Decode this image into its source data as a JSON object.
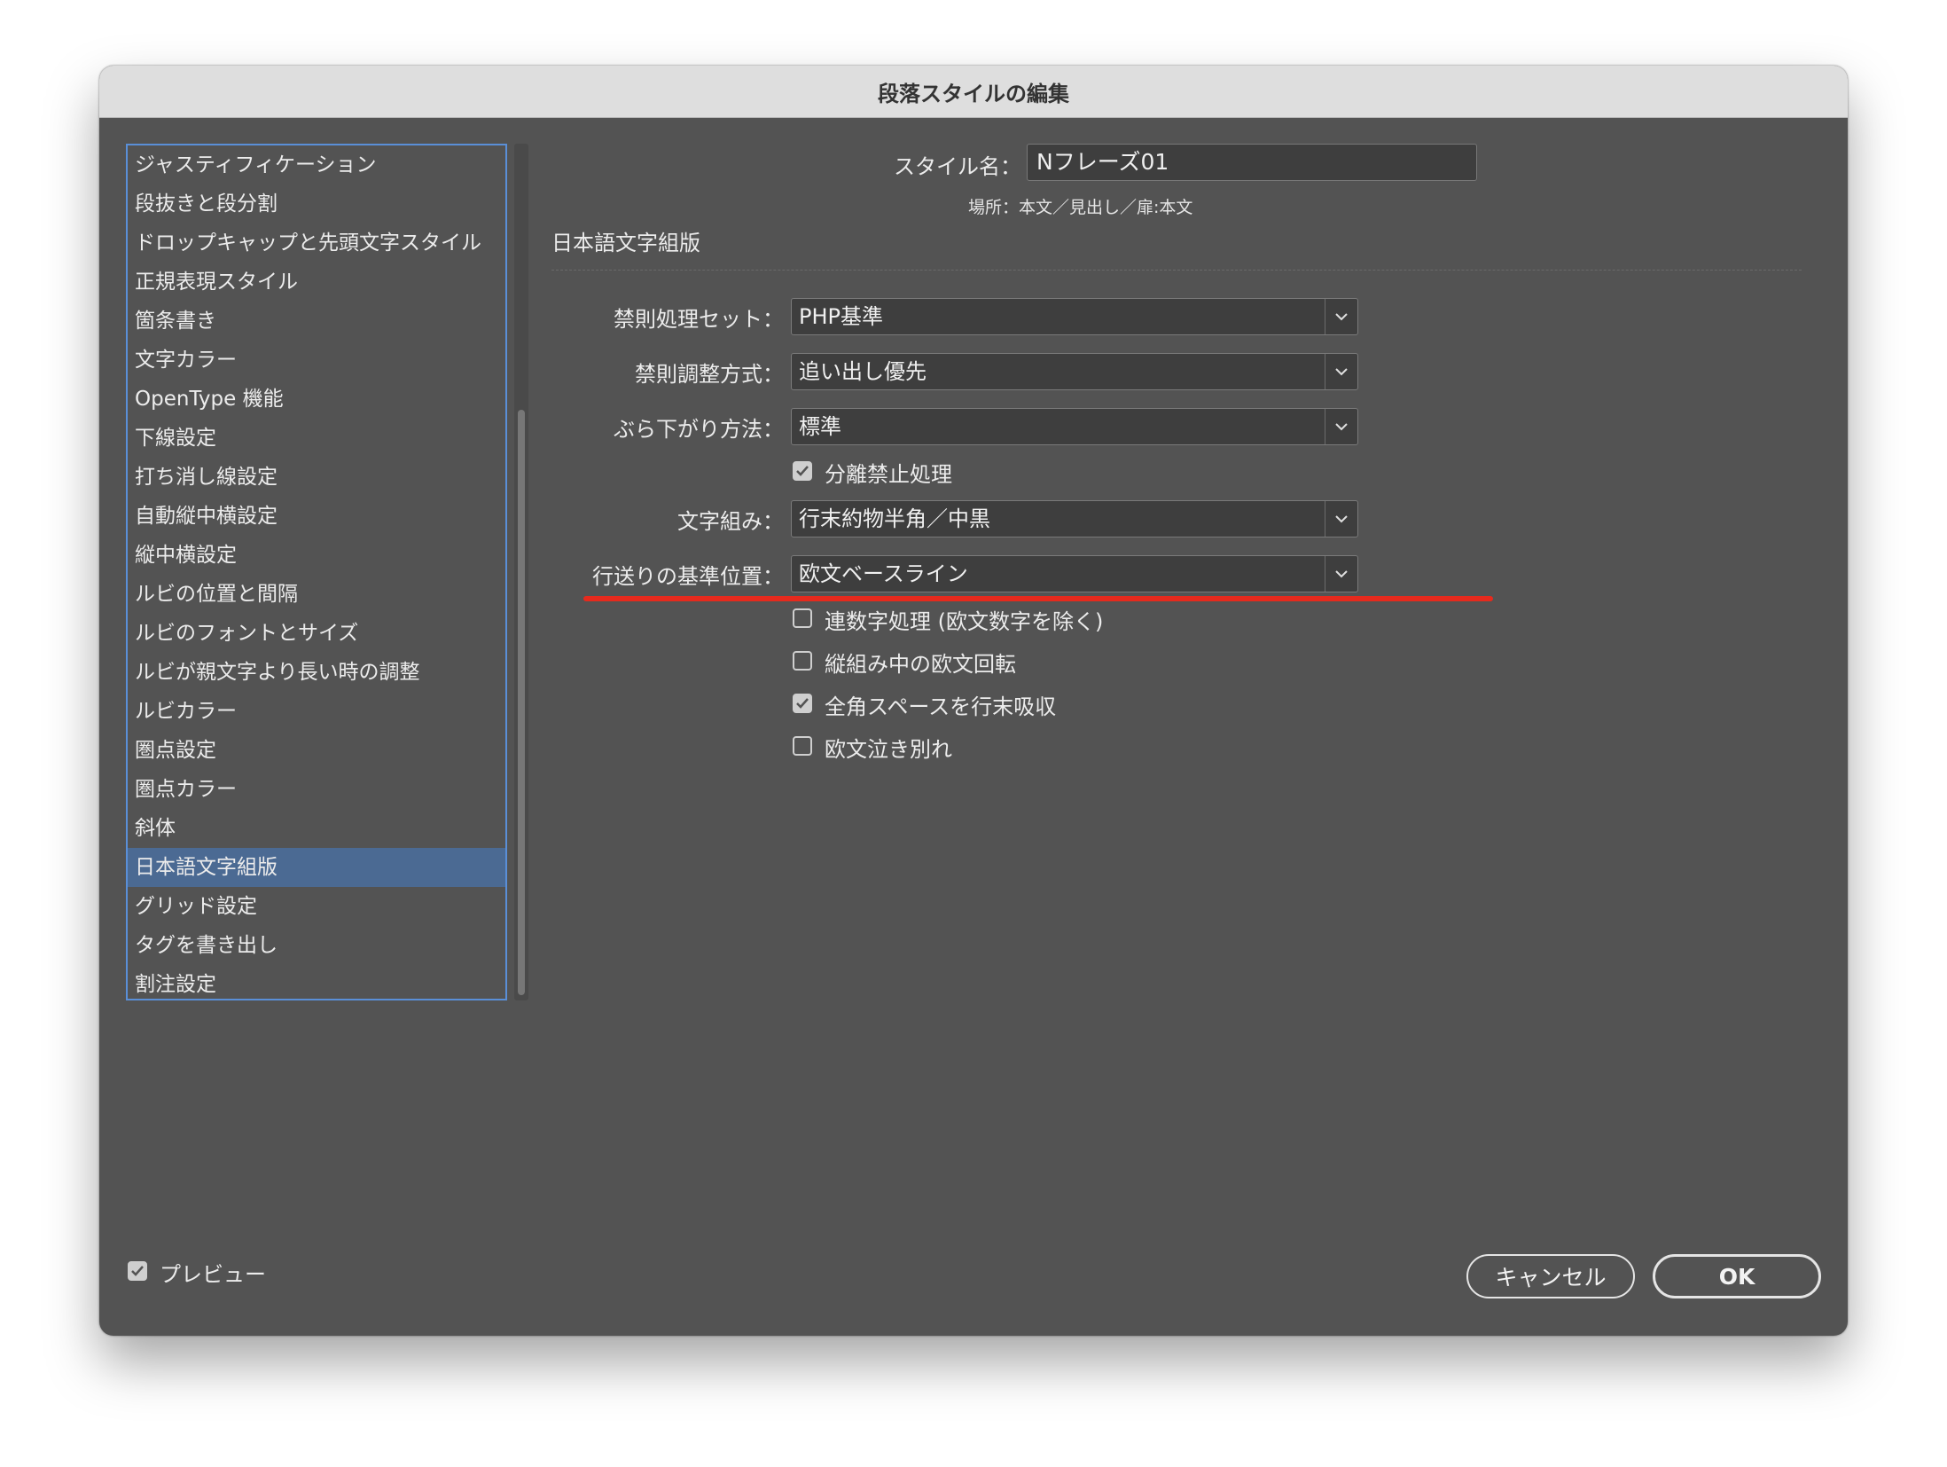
{
  "window": {
    "title": "段落スタイルの編集"
  },
  "sidebar": {
    "selected_index": 18,
    "items": [
      "ジャスティフィケーション",
      "段抜きと段分割",
      "ドロップキャップと先頭文字スタイル",
      "正規表現スタイル",
      "箇条書き",
      "文字カラー",
      "OpenType 機能",
      "下線設定",
      "打ち消し線設定",
      "自動縦中横設定",
      "縦中横設定",
      "ルビの位置と間隔",
      "ルビのフォントとサイズ",
      "ルビが親文字より長い時の調整",
      "ルビカラー",
      "圏点設定",
      "圏点カラー",
      "斜体",
      "日本語文字組版",
      "グリッド設定",
      "タグを書き出し",
      "割注設定"
    ]
  },
  "style_name": {
    "label": "スタイル名：",
    "value": "Nフレーズ01"
  },
  "location": "場所：本文／見出し／扉:本文",
  "section": {
    "title": "日本語文字組版"
  },
  "fields": {
    "kinsoku_set": {
      "label": "禁則処理セット：",
      "value": "PHP基準"
    },
    "kinsoku_adjust": {
      "label": "禁則調整方式：",
      "value": "追い出し優先"
    },
    "hanging": {
      "label": "ぶら下がり方法：",
      "value": "標準"
    },
    "no_break": {
      "label": "分離禁止処理",
      "checked": true
    },
    "mojikumi": {
      "label": "文字組み：",
      "value": "行末約物半角／中黒"
    },
    "leading_base": {
      "label": "行送りの基準位置：",
      "value": "欧文ベースライン"
    },
    "renzuuji": {
      "label": "連数字処理 (欧文数字を除く)",
      "checked": false
    },
    "tatechu_roman": {
      "label": "縦組み中の欧文回転",
      "checked": false
    },
    "zenkaku_space": {
      "label": "全角スペースを行末吸収",
      "checked": true
    },
    "oubun_nakiwakare": {
      "label": "欧文泣き別れ",
      "checked": false
    }
  },
  "preview": {
    "label": "プレビュー",
    "checked": true
  },
  "buttons": {
    "cancel": "キャンセル",
    "ok": "OK"
  },
  "colors": {
    "dialog_bg": "#535353",
    "selection": "#4b6a93",
    "focus_border": "#5a8fd8",
    "annotation_red": "#e62a1d"
  }
}
